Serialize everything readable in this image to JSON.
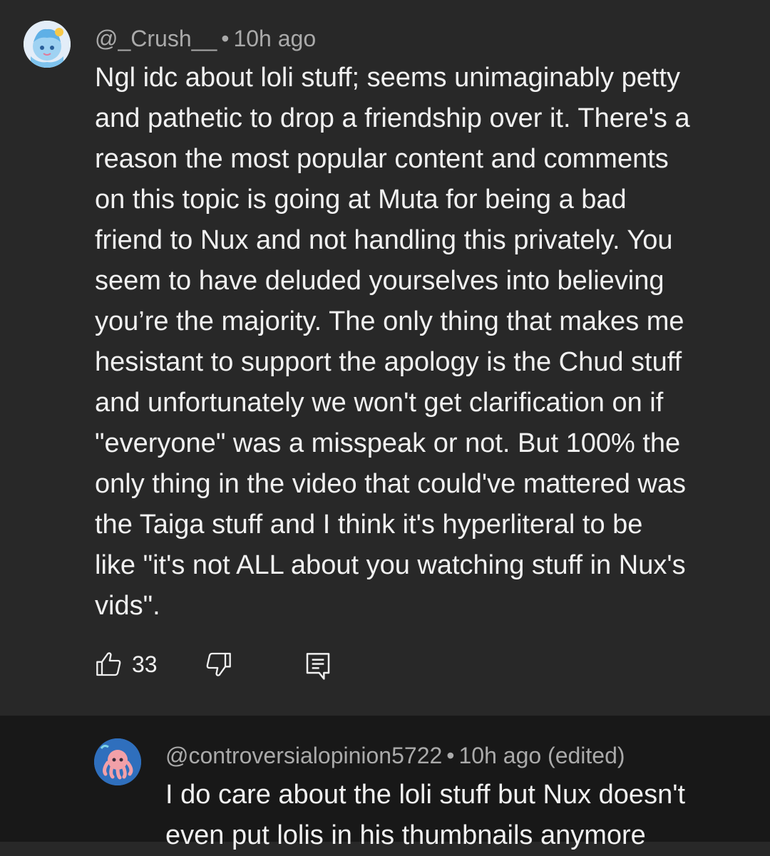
{
  "comment": {
    "author": "@_Crush__",
    "separator": "•",
    "time": "10h ago",
    "lines": [
      "Ngl idc about loli stuff; seems unimaginably petty",
      "and pathetic to drop a friendship over it. There's a",
      "reason the most popular content and comments",
      "on this topic is going at Muta for being a bad",
      "friend to Nux and not handling this privately. You",
      "seem to have deluded yourselves into believing",
      "you’re the majority. The only thing that  makes me",
      "hesistant to support the apology is the Chud stuff",
      "and unfortunately we won't get clarification on if",
      "\"everyone\" was a misspeak or not. But 100% the",
      "only thing in the video that could've mattered was",
      "the Taiga stuff and I think it's hyperliteral to be",
      "like \"it's not ALL about you watching stuff in Nux's",
      "vids\"."
    ],
    "like_count": "33",
    "icons": {
      "like": "thumbs-up-icon",
      "dislike": "thumbs-down-icon",
      "reply": "reply-comment-icon"
    }
  },
  "reply": {
    "author": "@controversialopinion5722",
    "separator": "•",
    "time": "10h ago (edited)",
    "lines": [
      "I do care about the loli stuff but Nux doesn't",
      "even put lolis in his thumbnails anymore"
    ]
  },
  "colors": {
    "background": "#282828",
    "reply_background": "#181818",
    "text": "#f1f1f1",
    "meta": "#aaaaaa"
  }
}
